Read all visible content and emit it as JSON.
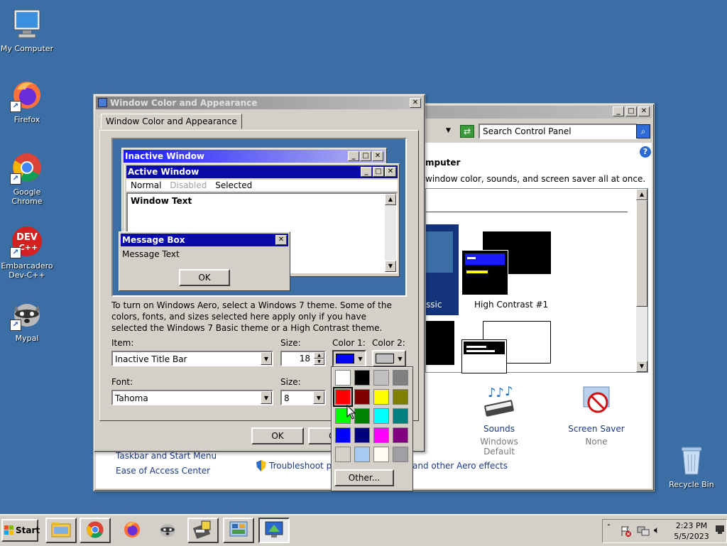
{
  "desktop": {
    "icons": [
      {
        "label": "My Computer"
      },
      {
        "label": "Firefox"
      },
      {
        "label": "Google Chrome"
      },
      {
        "label": "Embarcadero Dev-C++"
      },
      {
        "label": "Mypal"
      },
      {
        "label": "Recycle Bin"
      }
    ]
  },
  "control_panel": {
    "search_placeholder": "Search Control Panel",
    "heading_fragment": "mputer",
    "subtitle_fragment": "window color, sounds, and screen saver all at once.",
    "themes": [
      {
        "label": "ssic"
      },
      {
        "label": "High Contrast #1"
      }
    ],
    "sounds": {
      "title": "Sounds",
      "value": "Windows Default"
    },
    "screen_saver": {
      "title": "Screen Saver",
      "value": "None"
    },
    "left_links": [
      "Taskbar and Start Menu",
      "Ease of Access Center"
    ],
    "bottom_link_1": "Troubleshoot prob",
    "bottom_link_2": "and other Aero effects"
  },
  "dialog": {
    "title": "Window Color and Appearance",
    "tab": "Window Color and Appearance",
    "preview": {
      "inactive_title": "Inactive Window",
      "active_title": "Active Window",
      "menu_normal": "Normal",
      "menu_disabled": "Disabled",
      "menu_selected": "Selected",
      "window_text": "Window Text",
      "msgbox_title": "Message Box",
      "msgbox_text": "Message Text",
      "ok": "OK"
    },
    "info_text": "To turn on Windows Aero, select a Windows 7 theme.  Some of the colors, fonts, and sizes selected here apply only if you have selected the Windows 7 Basic theme or a High Contrast theme.",
    "item_label": "Item:",
    "item_value": "Inactive Title Bar",
    "size_label": "Size:",
    "size_value": "18",
    "color1_label": "Color 1:",
    "color2_label": "Color 2:",
    "color1": "#0000ff",
    "color2": "#c0c0c0",
    "font_label": "Font:",
    "font_value": "Tahoma",
    "font_size_label": "Size:",
    "font_size_value": "8",
    "ok_button": "OK",
    "cancel_button": "Ca"
  },
  "palette": {
    "colors": [
      "#ffffff",
      "#000000",
      "#c0c0c0",
      "#808080",
      "#ff0000",
      "#800000",
      "#ffff00",
      "#808000",
      "#00ff00",
      "#008000",
      "#00ffff",
      "#008080",
      "#0000ff",
      "#000080",
      "#ff00ff",
      "#800080",
      "#d4d0c8",
      "#a6caf0",
      "#fffbf0",
      "#a0a0a4"
    ],
    "selected_index": 4,
    "other_button": "Other..."
  },
  "taskbar": {
    "start_label": "Start",
    "clock_time": "2:23 PM",
    "clock_date": "5/5/2023"
  }
}
